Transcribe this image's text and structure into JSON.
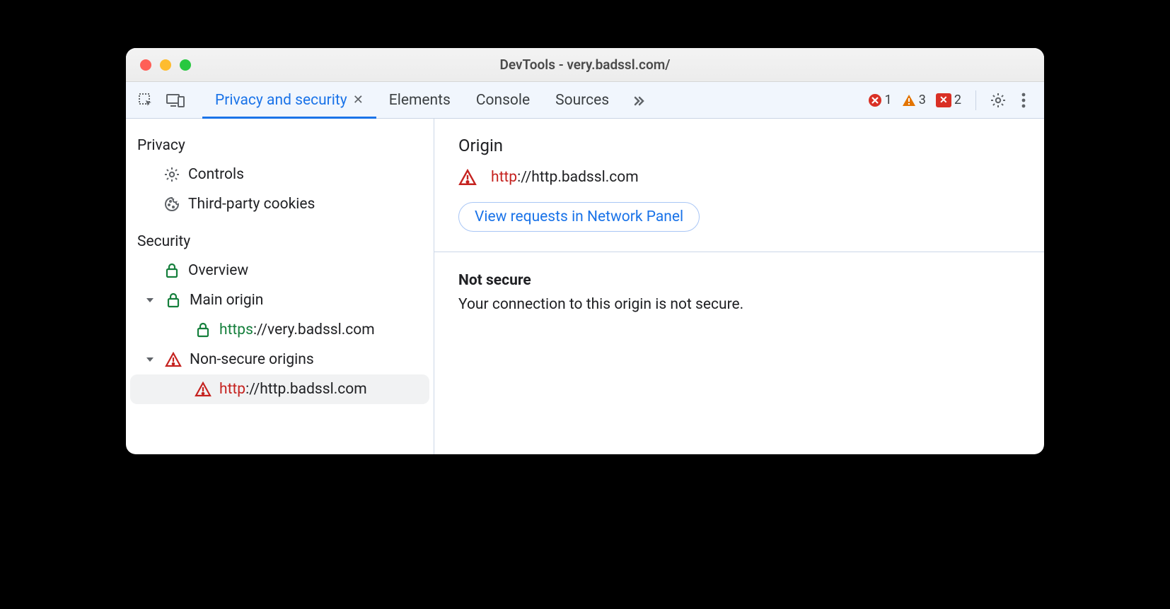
{
  "window": {
    "title": "DevTools - very.badssl.com/"
  },
  "toolbar": {
    "tabs": {
      "active": "Privacy and security",
      "others": [
        "Elements",
        "Console",
        "Sources"
      ]
    },
    "counts": {
      "errors": "1",
      "warnings": "3",
      "messages": "2"
    }
  },
  "sidebar": {
    "privacy_header": "Privacy",
    "privacy_items": {
      "controls": "Controls",
      "cookies": "Third-party cookies"
    },
    "security_header": "Security",
    "overview": "Overview",
    "main_origin_label": "Main origin",
    "main_origin_url": {
      "scheme": "https",
      "rest": "://very.badssl.com"
    },
    "nonsecure_label": "Non-secure origins",
    "nonsecure_url": {
      "scheme": "http",
      "rest": "://http.badssl.com"
    }
  },
  "main": {
    "origin_heading": "Origin",
    "origin_url": {
      "scheme": "http",
      "rest": "://http.badssl.com"
    },
    "view_requests_label": "View requests in Network Panel",
    "status_title": "Not secure",
    "status_desc": "Your connection to this origin is not secure."
  }
}
